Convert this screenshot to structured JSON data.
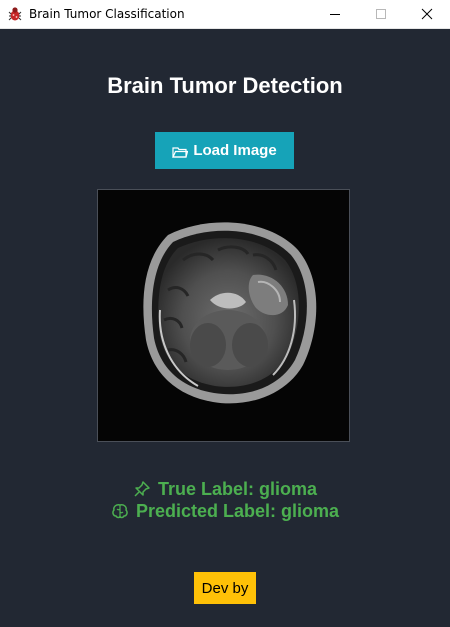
{
  "window": {
    "title": "Brain Tumor Classification",
    "icon": "app-icon-bug"
  },
  "main": {
    "heading": "Brain Tumor Detection",
    "load_button": {
      "label": "Load Image",
      "icon": "folder-icon",
      "color": "#16a3b8"
    },
    "image": {
      "description": "mri-scan"
    },
    "true_label": {
      "text": "True Label: glioma",
      "icon": "pushpin-icon"
    },
    "predicted_label": {
      "text": "Predicted Label: glioma",
      "icon": "brain-icon"
    },
    "label_color": "#4caf50",
    "dev_button": {
      "label": "Dev by",
      "color": "#ffc107"
    }
  },
  "colors": {
    "background": "#222833",
    "heading": "#ffffff"
  }
}
